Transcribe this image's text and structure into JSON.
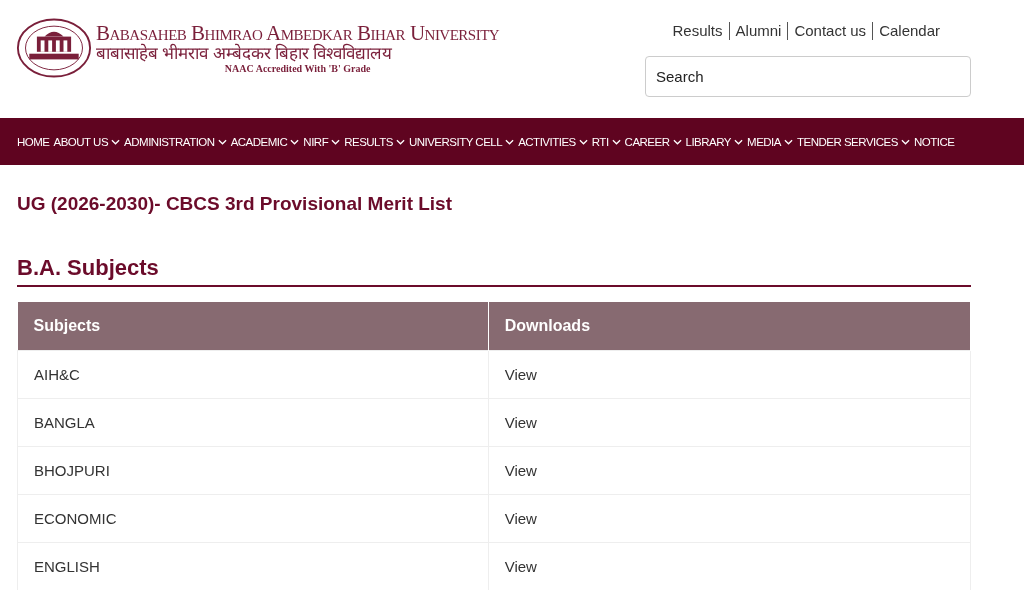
{
  "logo": {
    "title": "Babasaheb Bhimrao Ambedkar Bihar University",
    "subtitle": "बाबासाहेब भीमराव अम्बेदकर बिहार विश्वविद्यालय",
    "tagline": "NAAC Accredited With 'B' Grade"
  },
  "top_links": [
    "Results",
    "Alumni",
    "Contact us",
    "Calendar"
  ],
  "search": {
    "placeholder": "Search"
  },
  "nav": [
    {
      "label": "HOME",
      "dropdown": false
    },
    {
      "label": "ABOUT US",
      "dropdown": true
    },
    {
      "label": "ADMINISTRATION",
      "dropdown": true
    },
    {
      "label": "ACADEMIC",
      "dropdown": true
    },
    {
      "label": "NIRF",
      "dropdown": true
    },
    {
      "label": "RESULTS",
      "dropdown": true
    },
    {
      "label": "UNIVERSITY CELL",
      "dropdown": true
    },
    {
      "label": "ACTIVITIES",
      "dropdown": true
    },
    {
      "label": "RTI",
      "dropdown": true
    },
    {
      "label": "CAREER",
      "dropdown": true
    },
    {
      "label": "LIBRARY",
      "dropdown": true
    },
    {
      "label": "MEDIA",
      "dropdown": true
    },
    {
      "label": "TENDER SERVICES",
      "dropdown": true
    },
    {
      "label": "NOTICE",
      "dropdown": false
    }
  ],
  "page_title": "UG (2026-2030)- CBCS 3rd Provisional Merit List",
  "section_title": "B.A. Subjects",
  "table": {
    "columns": [
      "Subjects",
      "Downloads"
    ],
    "rows": [
      [
        "AIH&C",
        "View"
      ],
      [
        "BANGLA",
        "View"
      ],
      [
        "BHOJPURI",
        "View"
      ],
      [
        "ECONOMIC",
        "View"
      ],
      [
        "ENGLISH",
        "View"
      ]
    ]
  }
}
